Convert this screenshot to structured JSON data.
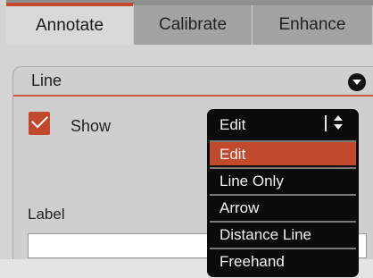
{
  "tabs": [
    {
      "label": "Annotate",
      "active": true
    },
    {
      "label": "Calibrate",
      "active": false
    },
    {
      "label": "Enhance",
      "active": false
    }
  ],
  "panel": {
    "title": "Line",
    "show_label": "Show",
    "show_checked": true,
    "label_caption": "Label",
    "label_value": ""
  },
  "dropdown": {
    "current": "Edit",
    "options": [
      {
        "label": "Edit",
        "selected": true
      },
      {
        "label": "Line Only",
        "selected": false
      },
      {
        "label": "Arrow",
        "selected": false
      },
      {
        "label": "Distance Line",
        "selected": false
      },
      {
        "label": "Freehand",
        "selected": false
      }
    ]
  },
  "colors": {
    "accent": "#c24a2c",
    "dropdown_bg": "#0b0b0b",
    "tab_bar": "#8f8f8f"
  },
  "icons": {
    "collapse": "collapse-down-icon",
    "dropdown_arrows": "up-down-arrows-icon",
    "checkbox": "checkmark-icon"
  }
}
